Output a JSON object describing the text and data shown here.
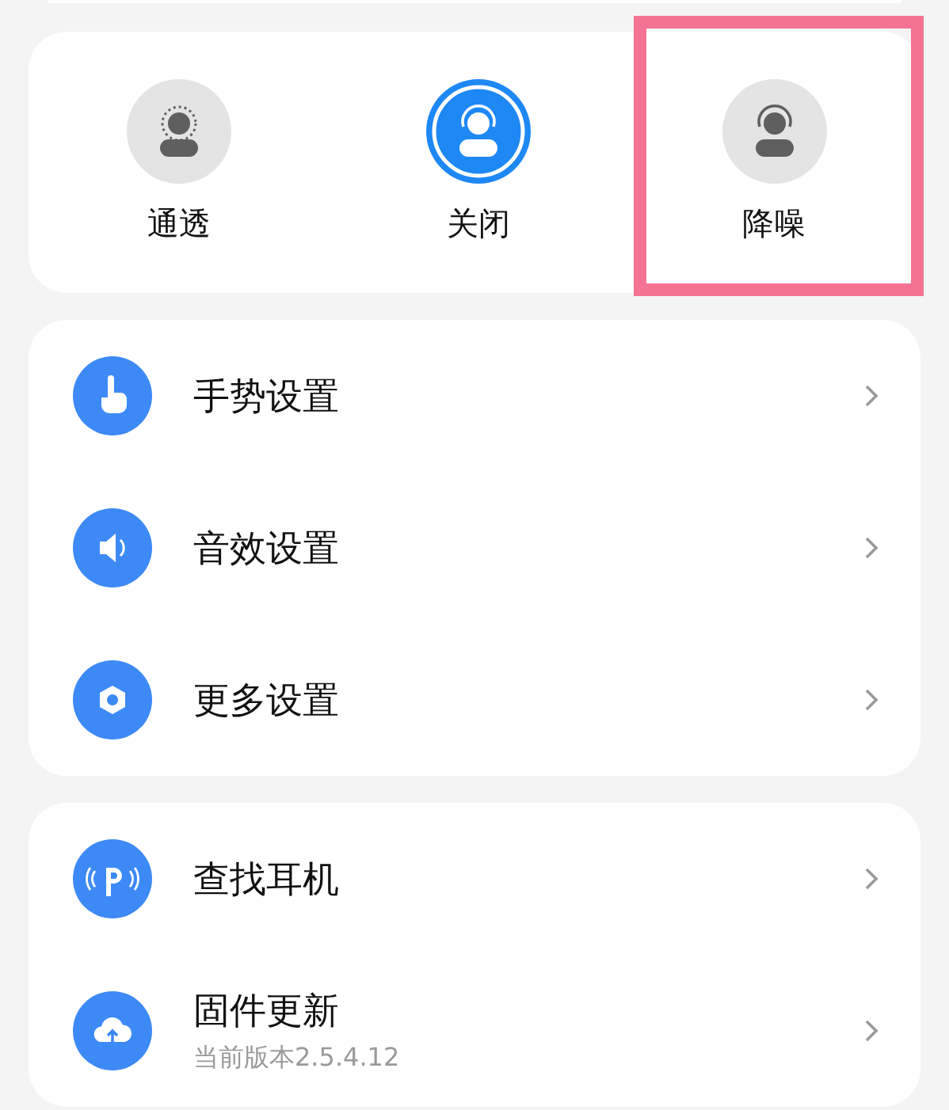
{
  "modes": [
    {
      "label": "通透",
      "selected": false,
      "highlighted": false,
      "kind": "transparency"
    },
    {
      "label": "关闭",
      "selected": true,
      "highlighted": false,
      "kind": "off"
    },
    {
      "label": "降噪",
      "selected": false,
      "highlighted": true,
      "kind": "noise"
    }
  ],
  "settings_groups": [
    {
      "items": [
        {
          "label": "手势设置",
          "kind": "gesture"
        },
        {
          "label": "音效设置",
          "kind": "sound"
        },
        {
          "label": "更多设置",
          "kind": "more"
        }
      ]
    },
    {
      "items": [
        {
          "label": "查找耳机",
          "kind": "find"
        },
        {
          "label": "固件更新",
          "kind": "update",
          "subtitle": "当前版本2.5.4.12"
        }
      ]
    }
  ]
}
